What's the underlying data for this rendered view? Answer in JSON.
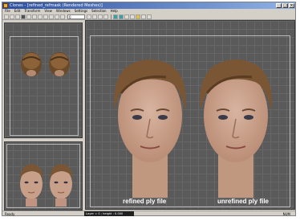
{
  "window": {
    "title": "Clones - [refined_refmask (Rendered Meshes)]",
    "controls": [
      "_",
      "□",
      "×"
    ]
  },
  "menu": [
    "File",
    "Edit",
    "Transform",
    "View",
    "Windows",
    "Settings",
    "Selection",
    "Help"
  ],
  "toolbar": {
    "field_value": "0"
  },
  "captions": {
    "left": "refined ply file",
    "right": "unrefined ply file"
  },
  "status": {
    "left": "Ready",
    "middle": "Layer = 0 ; height : 0.000 bottom",
    "right": "NUM"
  },
  "colors": {
    "viewport_bg": "#5a5a5a",
    "title_bar": "#2b4ea0"
  }
}
